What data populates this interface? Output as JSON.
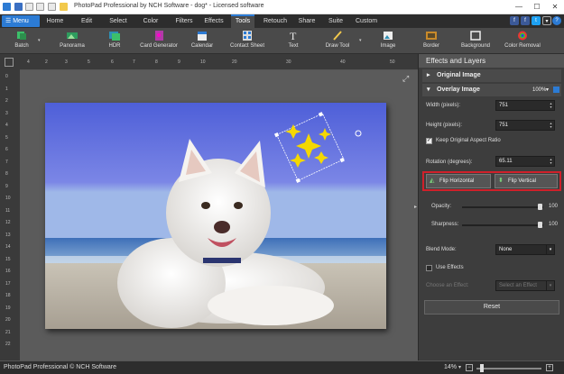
{
  "window": {
    "title": "PhotoPad Professional by NCH Software - dog* - Licensed software",
    "min_label": "—",
    "max_label": "☐",
    "close_label": "✕"
  },
  "menubar": {
    "menu_label": "☰ Menu",
    "tabs": [
      "Home",
      "Edit",
      "Select",
      "Color",
      "Filters",
      "Effects",
      "Tools",
      "Retouch",
      "Share",
      "Suite",
      "Custom"
    ],
    "active_tab": "Tools",
    "help_label": "?"
  },
  "ribbon": {
    "items": [
      {
        "label": "Batch",
        "icon": "batch-icon"
      },
      {
        "label": "Panorama",
        "icon": "panorama-icon"
      },
      {
        "label": "HDR",
        "icon": "hdr-icon"
      },
      {
        "label": "Card Generator",
        "icon": "card-icon"
      },
      {
        "label": "Calendar",
        "icon": "calendar-icon"
      },
      {
        "label": "Contact Sheet",
        "icon": "contact-sheet-icon"
      },
      {
        "label": "Text",
        "icon": "text-icon"
      },
      {
        "label": "Draw Tool",
        "icon": "draw-icon"
      },
      {
        "label": "Image",
        "icon": "image-icon"
      },
      {
        "label": "Border",
        "icon": "border-icon"
      },
      {
        "label": "Background",
        "icon": "background-icon"
      },
      {
        "label": "Color Removal",
        "icon": "color-removal-icon"
      }
    ]
  },
  "ruler": {
    "h_ticks": [
      "4",
      "2",
      "3",
      "5",
      "6",
      "7",
      "8",
      "9",
      "10",
      "20",
      "30",
      "40",
      "50"
    ],
    "v_ticks": [
      "0",
      "1",
      "2",
      "3",
      "4",
      "5",
      "6",
      "7",
      "8",
      "9",
      "10",
      "11",
      "12",
      "13",
      "14",
      "15",
      "16",
      "17",
      "18",
      "19",
      "20",
      "21",
      "22"
    ]
  },
  "panel": {
    "header": "Effects and Layers",
    "section_original": "Original Image",
    "section_overlay": "Overlay Image",
    "overlay_zoom": "100%",
    "width_label": "Width (pixels):",
    "width_value": "751",
    "height_label": "Height (pixels):",
    "height_value": "751",
    "keep_ratio_label": "Keep Original Aspect Ratio",
    "keep_ratio_checked": true,
    "rotation_label": "Rotation (degrees):",
    "rotation_value": "65.11",
    "flip_horizontal": "Flip Horizontal",
    "flip_vertical": "Flip Vertical",
    "opacity_label": "Opacity:",
    "opacity_value": "100",
    "sharpness_label": "Sharpness:",
    "sharpness_value": "100",
    "blend_label": "Blend Mode:",
    "blend_value": "None",
    "use_effects_label": "Use Effects",
    "choose_effect_label": "Choose an Effect:",
    "choose_effect_value": "Select an Effect",
    "reset_label": "Reset"
  },
  "status": {
    "copyright": "PhotoPad Professional © NCH Software",
    "zoom": "14%"
  },
  "colors": {
    "accent": "#2c7bd4",
    "highlight": "#d0202a",
    "star": "#f5d800",
    "sky": "#5b6ce0"
  }
}
